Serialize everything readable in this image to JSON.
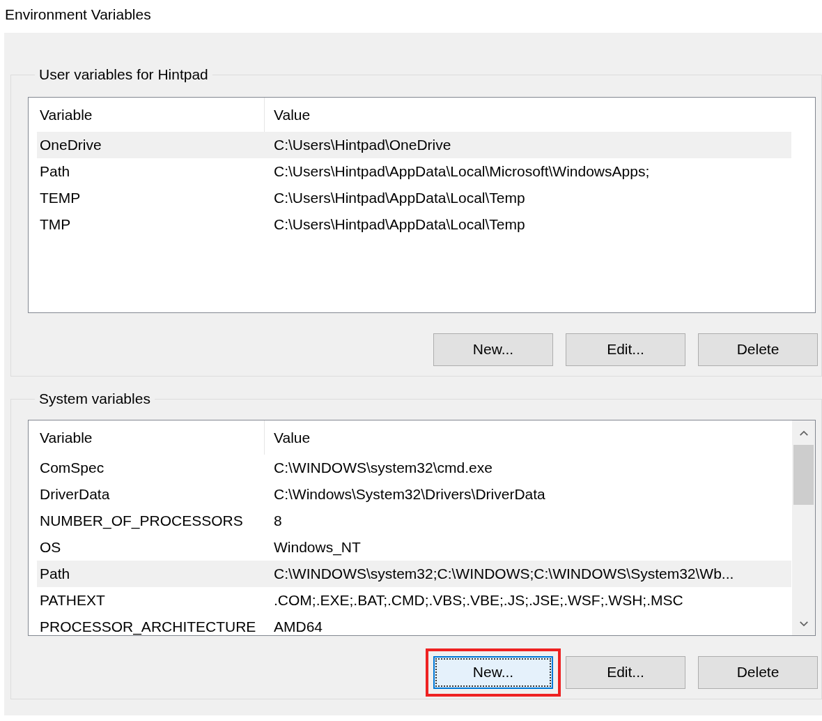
{
  "window": {
    "title": "Environment Variables"
  },
  "groups": [
    {
      "title": "User variables for Hintpad",
      "scrollbar": false,
      "columns": [
        "Variable",
        "Value"
      ],
      "rows": [
        {
          "variable": "OneDrive",
          "value": "C:\\Users\\Hintpad\\OneDrive",
          "selected": true
        },
        {
          "variable": "Path",
          "value": "C:\\Users\\Hintpad\\AppData\\Local\\Microsoft\\WindowsApps;",
          "selected": false
        },
        {
          "variable": "TEMP",
          "value": "C:\\Users\\Hintpad\\AppData\\Local\\Temp",
          "selected": false
        },
        {
          "variable": "TMP",
          "value": "C:\\Users\\Hintpad\\AppData\\Local\\Temp",
          "selected": false
        }
      ],
      "buttons": [
        {
          "label": "New...",
          "focused": false,
          "highlighted": false
        },
        {
          "label": "Edit...",
          "focused": false,
          "highlighted": false
        },
        {
          "label": "Delete",
          "focused": false,
          "highlighted": false
        }
      ]
    },
    {
      "title": "System variables",
      "scrollbar": true,
      "columns": [
        "Variable",
        "Value"
      ],
      "rows": [
        {
          "variable": "ComSpec",
          "value": "C:\\WINDOWS\\system32\\cmd.exe",
          "selected": false
        },
        {
          "variable": "DriverData",
          "value": "C:\\Windows\\System32\\Drivers\\DriverData",
          "selected": false
        },
        {
          "variable": "NUMBER_OF_PROCESSORS",
          "value": "8",
          "selected": false
        },
        {
          "variable": "OS",
          "value": "Windows_NT",
          "selected": false
        },
        {
          "variable": "Path",
          "value": "C:\\WINDOWS\\system32;C:\\WINDOWS;C:\\WINDOWS\\System32\\Wb...",
          "selected": true
        },
        {
          "variable": "PATHEXT",
          "value": ".COM;.EXE;.BAT;.CMD;.VBS;.VBE;.JS;.JSE;.WSF;.WSH;.MSC",
          "selected": false
        },
        {
          "variable": "PROCESSOR_ARCHITECTURE",
          "value": "AMD64",
          "selected": false
        }
      ],
      "buttons": [
        {
          "label": "New...",
          "focused": true,
          "highlighted": true
        },
        {
          "label": "Edit...",
          "focused": false,
          "highlighted": false
        },
        {
          "label": "Delete",
          "focused": false,
          "highlighted": false
        }
      ]
    }
  ]
}
